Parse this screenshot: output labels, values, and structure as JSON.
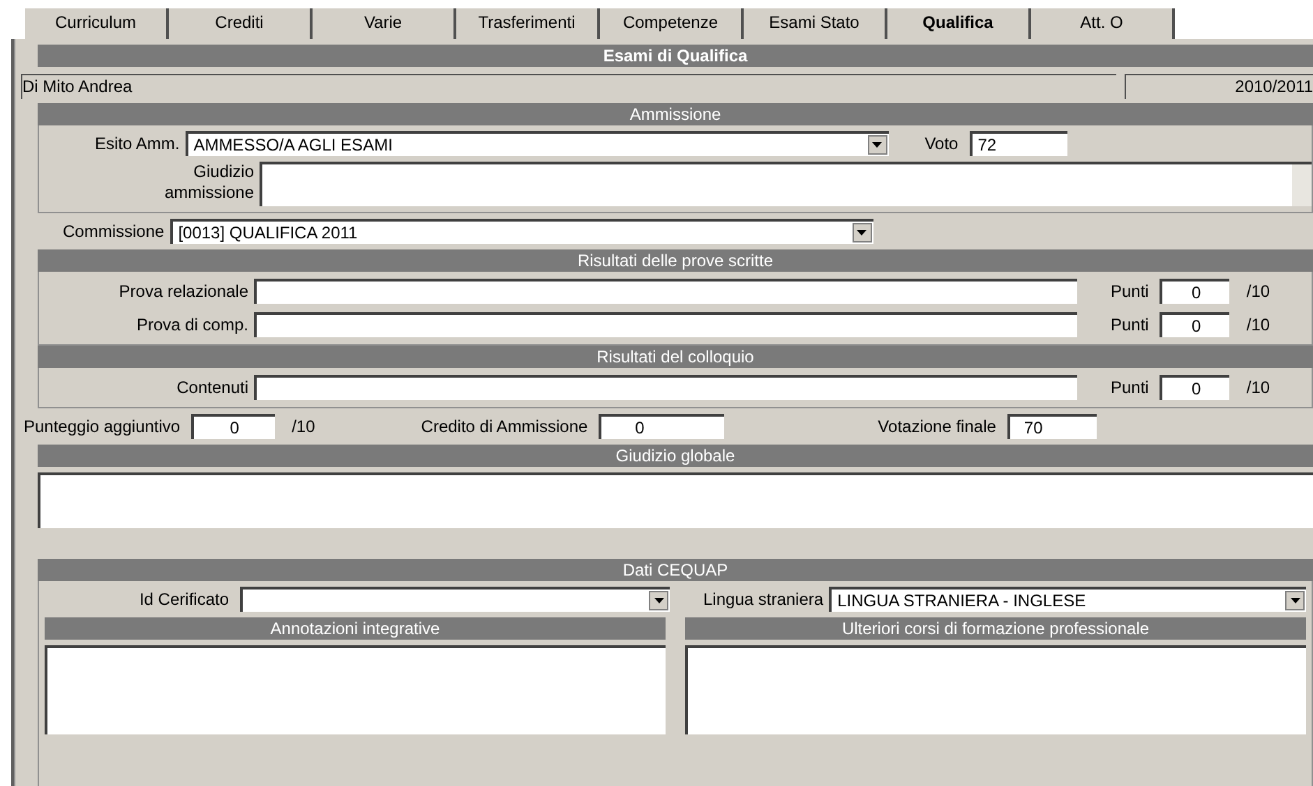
{
  "tabs": [
    {
      "label": "Curriculum",
      "selected": false
    },
    {
      "label": "Crediti",
      "selected": false
    },
    {
      "label": "Varie",
      "selected": false
    },
    {
      "label": "Trasferimenti",
      "selected": false
    },
    {
      "label": "Competenze",
      "selected": false
    },
    {
      "label": "Esami Stato",
      "selected": false
    },
    {
      "label": "Qualifica",
      "selected": true
    },
    {
      "label": "Att. O",
      "selected": false
    }
  ],
  "title": "Esami di Qualifica",
  "student": {
    "name": "Di Mito Andrea",
    "year": "2010/2011"
  },
  "ammissione": {
    "header": "Ammissione",
    "esito_label": "Esito Amm.",
    "esito_value": "AMMESSO/A AGLI ESAMI",
    "voto_label": "Voto",
    "voto_value": "72",
    "giudizio_label": [
      "Giudizio",
      "ammissione"
    ],
    "commissione_label": "Commissione",
    "commissione_value": "[0013] QUALIFICA 2011"
  },
  "prove_scritte": {
    "header": "Risultati delle prove scritte",
    "rows": [
      {
        "label": "Prova relazionale",
        "punti_label": "Punti",
        "punti": "0",
        "max": "/10"
      },
      {
        "label": "Prova di comp.",
        "punti_label": "Punti",
        "punti": "0",
        "max": "/10"
      }
    ]
  },
  "colloquio": {
    "header": "Risultati del colloquio",
    "rows": [
      {
        "label": "Contenuti",
        "punti_label": "Punti",
        "punti": "0",
        "max": "/10"
      }
    ]
  },
  "totali": {
    "aggiuntivo_label": "Punteggio aggiuntivo",
    "aggiuntivo": "0",
    "aggiuntivo_max": "/10",
    "credito_label": "Credito di Ammissione",
    "credito": "0",
    "finale_label": "Votazione finale",
    "finale": "70"
  },
  "giudizio_globale": {
    "header": "Giudizio globale"
  },
  "cequap": {
    "header": "Dati CEQUAP",
    "id_label": "Id Cerificato",
    "lingua_label": "Lingua straniera",
    "lingua_value": "LINGUA STRANIERA - INGLESE",
    "annotazioni_header": "Annotazioni integrative",
    "corsi_header": "Ulteriori corsi di formazione professionale"
  }
}
